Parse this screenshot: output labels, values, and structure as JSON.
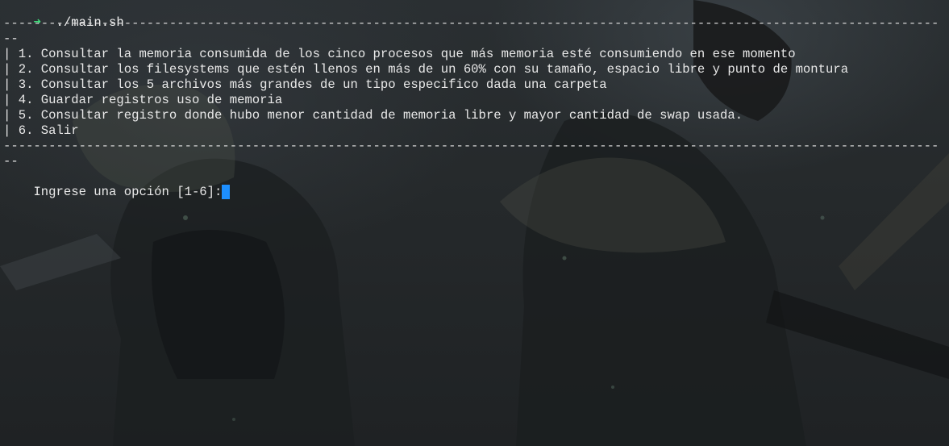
{
  "command": {
    "arrow_icon": "right-arrow-icon",
    "arrow_glyph": "➜",
    "text": "./main.sh"
  },
  "divider": {
    "dashes": "------------------------------------------------------------------------------------------------------------------------------------------------------",
    "wrap": "--"
  },
  "menu": {
    "items": [
      "| 1. Consultar la memoria consumida de los cinco procesos que más memoria esté consumiendo en ese momento",
      "| 2. Consultar los filesystems que estén llenos en más de un 60% con su tamaño, espacio libre y punto de montura",
      "| 3. Consultar los 5 archivos más grandes de un tipo especifico dada una carpeta",
      "| 4. Guardar registros uso de memoria",
      "| 5. Consultar registro donde hubo menor cantidad de memoria libre y mayor cantidad de swap usada.",
      "| 6. Salir"
    ]
  },
  "input": {
    "prompt": "Ingrese una opción [1-6]:"
  },
  "colors": {
    "arrow": "#3ee27d",
    "text": "#e9e9e9",
    "cursor": "#1d8fff",
    "background": "#23272a"
  }
}
